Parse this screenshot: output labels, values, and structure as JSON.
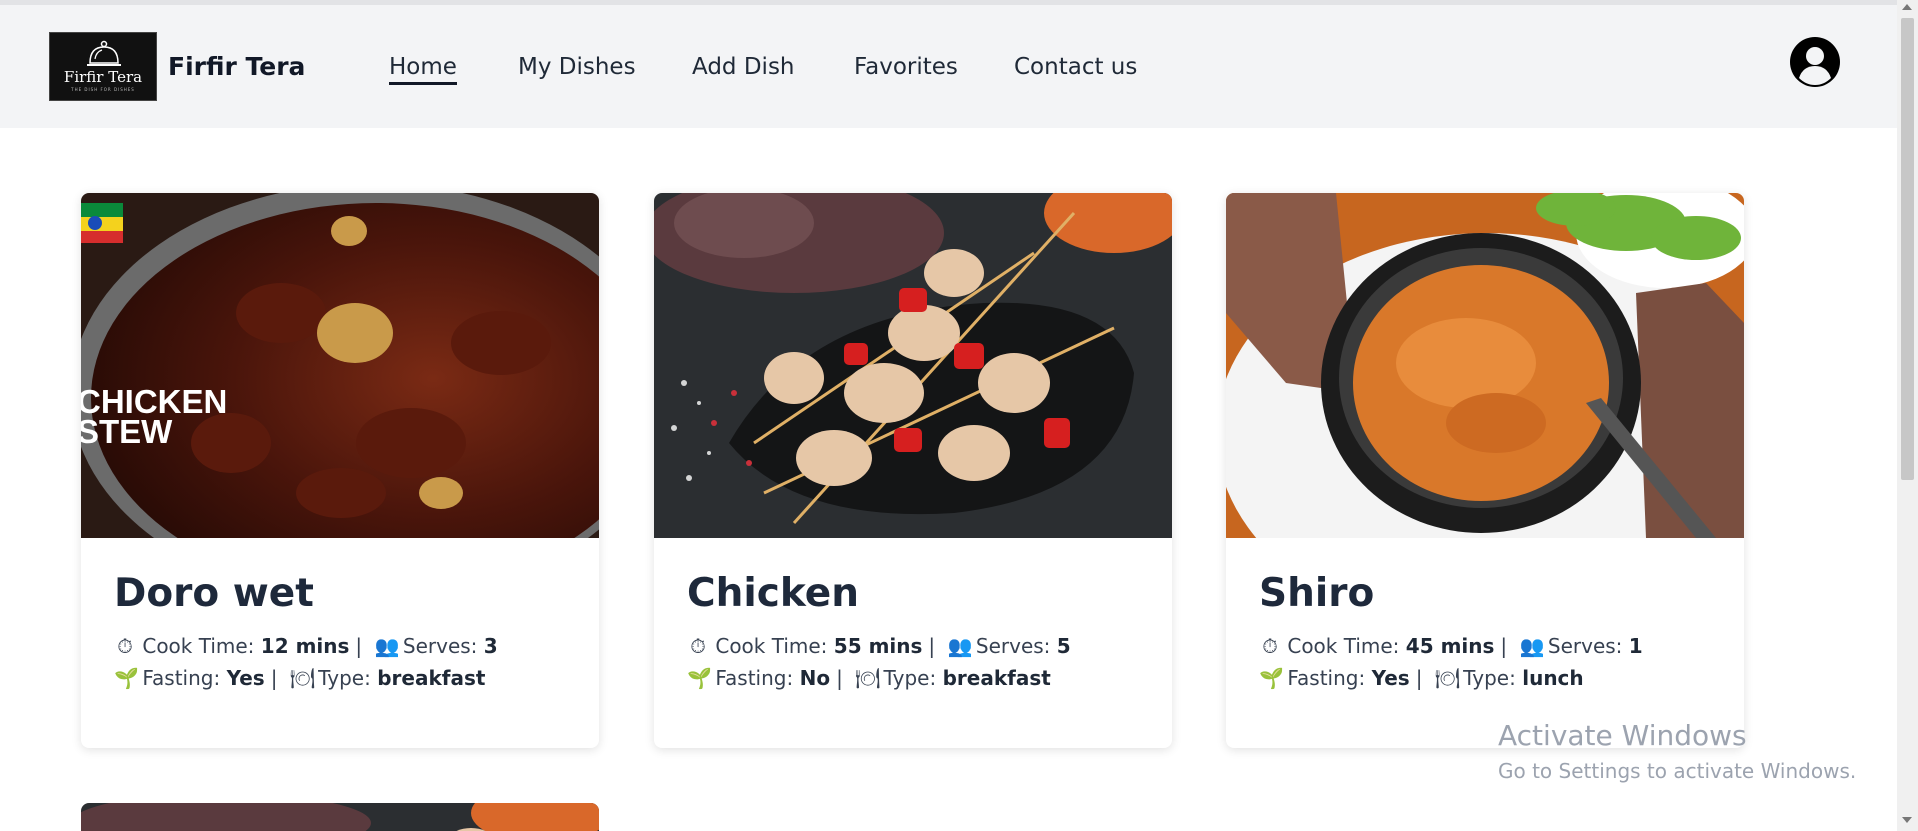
{
  "header": {
    "logo_text": "Firfir Tera",
    "logo_tagline": "THE DISH FOR DISHES",
    "brand": "Firfir Tera",
    "nav": [
      {
        "label": "Home",
        "active": true
      },
      {
        "label": "My Dishes",
        "active": false
      },
      {
        "label": "Add Dish",
        "active": false
      },
      {
        "label": "Favorites",
        "active": false
      },
      {
        "label": "Contact us",
        "active": false
      }
    ],
    "user_icon": "user-circle-icon"
  },
  "dishes": [
    {
      "title": "Doro wet",
      "image_overlay": "CHICKEN STEW",
      "cook_time_label": "Cook Time:",
      "cook_time": "12 mins",
      "serves_label": "Serves:",
      "serves": "3",
      "fasting_label": "Fasting:",
      "fasting": "Yes",
      "type_label": "Type:",
      "type": "breakfast"
    },
    {
      "title": "Chicken",
      "cook_time_label": "Cook Time:",
      "cook_time": "55 mins",
      "serves_label": "Serves:",
      "serves": "5",
      "fasting_label": "Fasting:",
      "fasting": "No",
      "type_label": "Type:",
      "type": "breakfast"
    },
    {
      "title": "Shiro",
      "cook_time_label": "Cook Time:",
      "cook_time": "45 mins",
      "serves_label": "Serves:",
      "serves": "1",
      "fasting_label": "Fasting:",
      "fasting": "Yes",
      "type_label": "Type:",
      "type": "lunch"
    }
  ],
  "watermark": {
    "line1": "Activate Windows",
    "line2": "Go to Settings to activate Windows."
  },
  "colors": {
    "navbar_bg": "#f3f4f6",
    "title": "#1e293b"
  }
}
